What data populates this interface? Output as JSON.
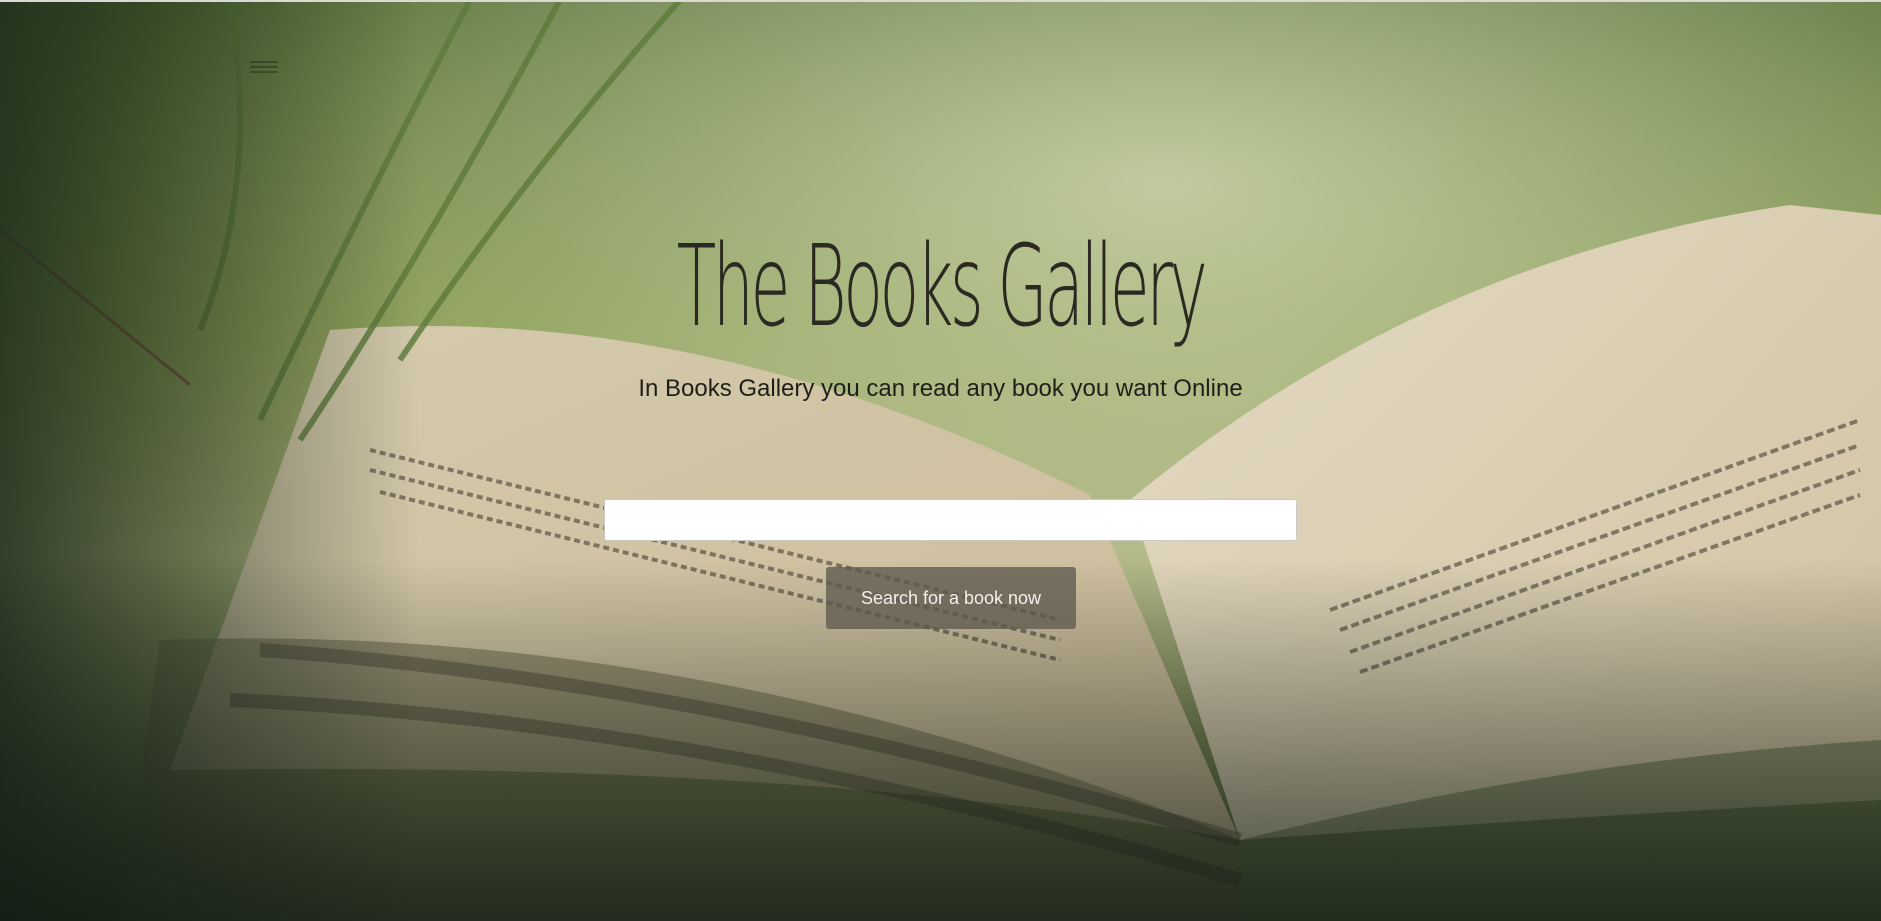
{
  "header": {
    "menu_icon": "hamburger-menu-icon"
  },
  "hero": {
    "title": "The Books Gallery",
    "subtitle": "In Books Gallery you can read any book you want Online",
    "background": "open-book-in-grass-photo"
  },
  "search": {
    "input_value": "",
    "placeholder": "",
    "button_label": "Search for a book now"
  },
  "colors": {
    "button_bg": "#5f5a50",
    "button_text": "#f3f1ec",
    "title_text": "#2a2a22"
  }
}
